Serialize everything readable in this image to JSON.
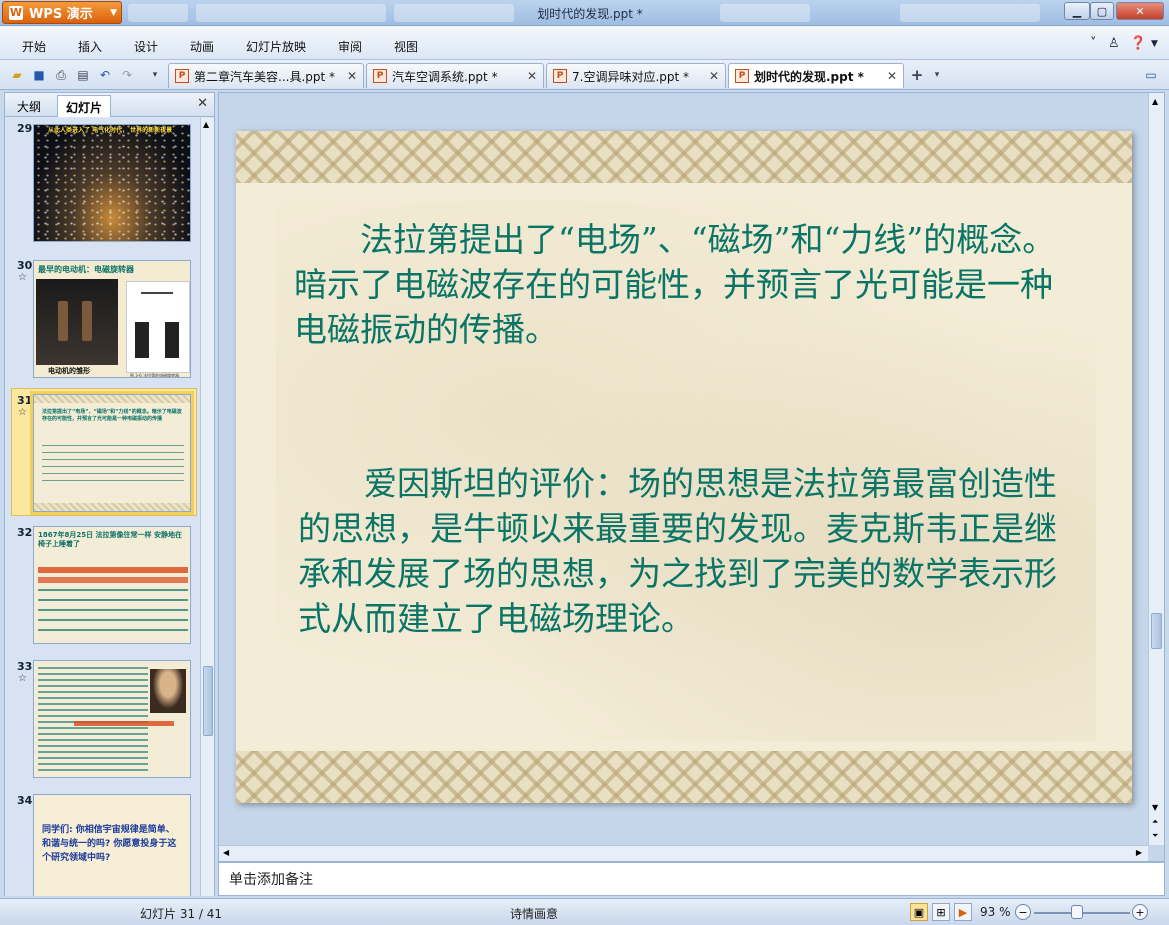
{
  "app": {
    "name": "WPS 演示",
    "window_title": "划时代的发现.ppt *"
  },
  "menu": [
    "开始",
    "插入",
    "设计",
    "动画",
    "幻灯片放映",
    "审阅",
    "视图"
  ],
  "tabs": [
    {
      "label": "第二章汽车美容...具.ppt *",
      "active": false
    },
    {
      "label": "汽车空调系统.ppt *",
      "active": false
    },
    {
      "label": "7.空调异味对应.ppt *",
      "active": false
    },
    {
      "label": "划时代的发现.ppt *",
      "active": true
    }
  ],
  "panel": {
    "tabs": [
      "大纲",
      "幻灯片"
    ],
    "active_tab": "幻灯片"
  },
  "thumbnails": [
    {
      "num": "29",
      "caption": "从此人类进入了 电气化时代， 世界的新新夜景"
    },
    {
      "num": "30",
      "caption": "最早的电动机：电磁旋转器",
      "sub": "电动机的雏形",
      "fig": "图 3-6 法拉第的电磁旋转器"
    },
    {
      "num": "31",
      "caption": "法拉第提出了“电场”、“磁场”和“力线”的概念。暗示了电磁波存在的可能性，并预言了光可能是一种电磁振动的传播"
    },
    {
      "num": "32",
      "caption": "1867年8月25日 法拉第像往常一样 安静地在椅子上睡着了"
    },
    {
      "num": "33",
      "caption": ""
    },
    {
      "num": "34",
      "caption": "同学们: 你相信宇宙规律是简单、和谐与统一的吗? 你愿意投身于这个研究领域中吗?"
    }
  ],
  "slide": {
    "para1": "　　法拉第提出了“电场”、“磁场”和“力线”的概念。暗示了电磁波存在的可能性，并预言了光可能是一种电磁振动的传播。",
    "para2": "　　爱因斯坦的评价：场的思想是法拉第最富创造性的思想，是牛顿以来最重要的发现。麦克斯韦正是继承和发展了场的思想，为之找到了完美的数学表示形式从而建立了电磁场理论。"
  },
  "notes_placeholder": "单击添加备注",
  "status": {
    "slide_pos": "幻灯片 31 / 41",
    "theme": "诗情画意",
    "zoom": "93 %",
    "zoom_fraction": 0.45
  },
  "colors": {
    "slide_text": "#0a7566",
    "accent_orange": "#d9620f"
  }
}
